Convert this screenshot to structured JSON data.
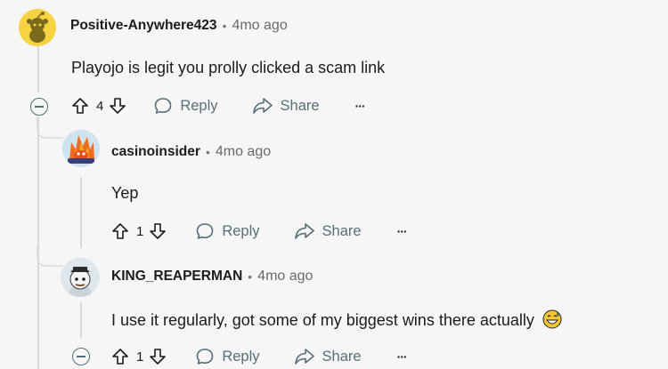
{
  "comments": [
    {
      "username": "Positive-Anywhere423",
      "separator": "•",
      "time": "4mo ago",
      "body": "Playojo is legit you prolly clicked a scam link",
      "votes": "4",
      "reply_label": "Reply",
      "share_label": "Share",
      "more_label": "···"
    },
    {
      "username": "casinoinsider",
      "separator": "•",
      "time": "4mo ago",
      "body": "Yep",
      "votes": "1",
      "reply_label": "Reply",
      "share_label": "Share",
      "more_label": "···"
    },
    {
      "username": "KING_REAPERMAN",
      "separator": "•",
      "time": "4mo ago",
      "body": "I use it regularly, got some of my biggest wins there actually",
      "emoji": "grinning-sweat-emoji",
      "votes": "1",
      "reply_label": "Reply",
      "share_label": "Share",
      "more_label": "···"
    }
  ],
  "colors": {
    "background": "#f6f6f6",
    "text": "#1c1c1c",
    "muted": "#576f76",
    "thread_line": "#d7dadc"
  }
}
